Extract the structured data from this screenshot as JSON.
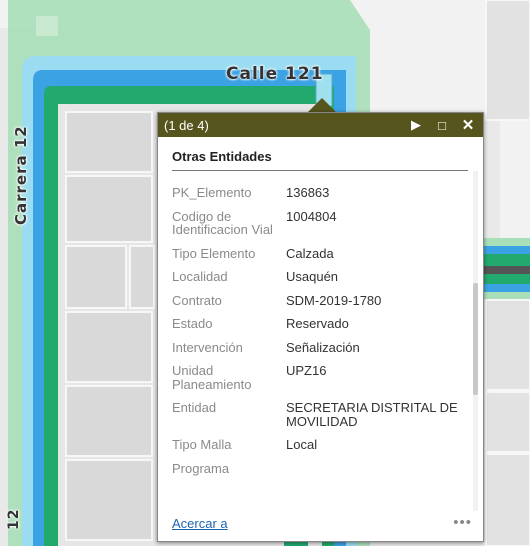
{
  "map": {
    "street_calle": "Calle 121",
    "street_carrera": "Carrera 12",
    "street_carrera_bottom": "12"
  },
  "popup": {
    "counter": "(1 de 4)",
    "title": "Otras Entidades",
    "attributes": [
      {
        "key": "PK_Elemento",
        "value": "136863"
      },
      {
        "key": "Codigo de Identificacion Vial",
        "value": "1004804"
      },
      {
        "key": "Tipo Elemento",
        "value": "Calzada"
      },
      {
        "key": "Localidad",
        "value": "Usaquén"
      },
      {
        "key": "Contrato",
        "value": "SDM-2019-1780"
      },
      {
        "key": "Estado",
        "value": "Reservado"
      },
      {
        "key": "Intervención",
        "value": "Señalización"
      },
      {
        "key": "Unidad Planeamiento",
        "value": "UPZ16"
      },
      {
        "key": "Entidad",
        "value": "SECRETARIA DISTRITAL DE MOVILIDAD"
      },
      {
        "key": "Tipo Malla",
        "value": "Local"
      },
      {
        "key": "Programa",
        "value": ""
      }
    ],
    "footer_link": "Acercar a",
    "more": "•••"
  },
  "colors": {
    "header": "#56551d",
    "road_green": "#22a96e",
    "road_blue": "#3ba2e4",
    "road_light": "#9bdcf2",
    "link": "#1a66b0"
  },
  "icons": {
    "next": "next-icon",
    "maximize": "maximize-icon",
    "close": "close-icon"
  }
}
